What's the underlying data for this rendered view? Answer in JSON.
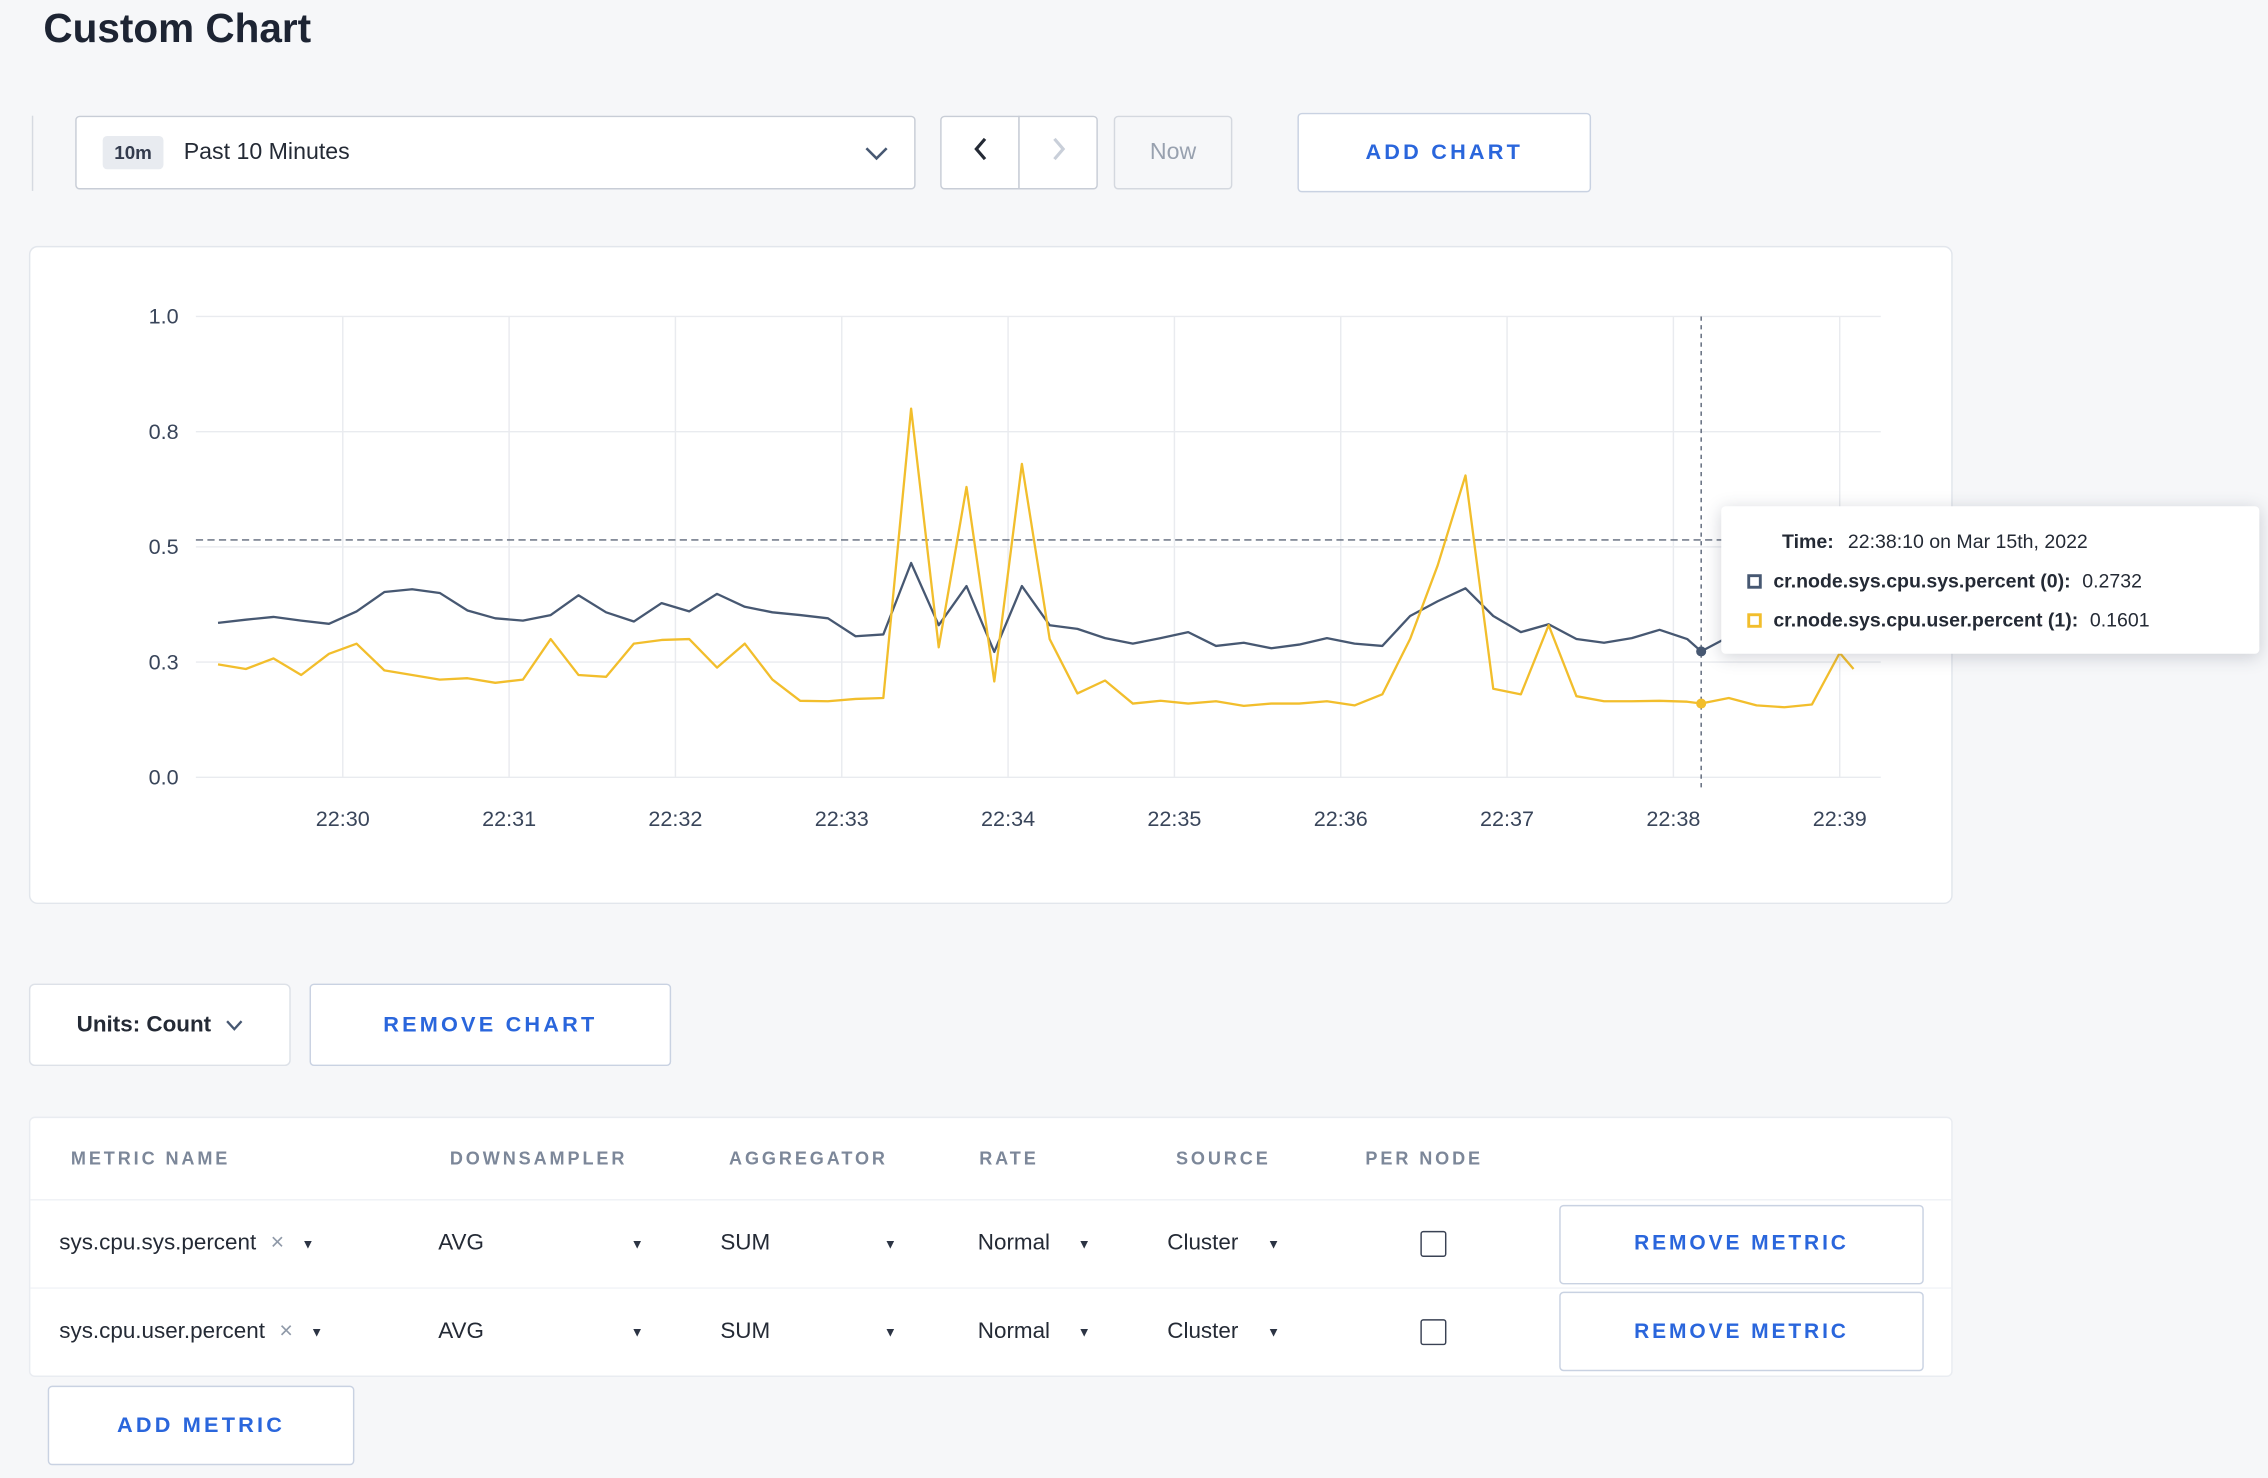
{
  "page": {
    "title": "Custom Chart"
  },
  "colors": {
    "accent": "#2a66dc",
    "series_sys": "#475872",
    "series_user": "#f2be2c"
  },
  "toolbar": {
    "time_badge": "10m",
    "time_label": "Past 10 Minutes",
    "now_label": "Now",
    "add_chart_label": "ADD CHART"
  },
  "chart_controls": {
    "units_label": "Units: Count",
    "remove_chart_label": "REMOVE CHART"
  },
  "metrics_table": {
    "headers": [
      "METRIC NAME",
      "DOWNSAMPLER",
      "AGGREGATOR",
      "RATE",
      "SOURCE",
      "PER NODE"
    ],
    "rows": [
      {
        "name": "sys.cpu.sys.percent",
        "downsampler": "AVG",
        "aggregator": "SUM",
        "rate": "Normal",
        "source": "Cluster",
        "per_node_checked": false,
        "remove_label": "REMOVE METRIC"
      },
      {
        "name": "sys.cpu.user.percent",
        "downsampler": "AVG",
        "aggregator": "SUM",
        "rate": "Normal",
        "source": "Cluster",
        "per_node_checked": false,
        "remove_label": "REMOVE METRIC"
      }
    ],
    "add_metric_label": "ADD METRIC"
  },
  "chart_data": {
    "type": "line",
    "x_axis": {
      "unit": "minutes after 22:30",
      "ticks": [
        0,
        1,
        2,
        3,
        4,
        5,
        6,
        7,
        8,
        9
      ],
      "tick_labels": [
        "22:30",
        "22:31",
        "22:32",
        "22:33",
        "22:34",
        "22:35",
        "22:36",
        "22:37",
        "22:38",
        "22:39"
      ],
      "range": [
        -0.883,
        9.25
      ]
    },
    "y_axis": {
      "ticks": [
        0,
        0.25,
        0.5,
        0.75,
        1.0
      ],
      "tick_labels": [
        "0.0",
        "0.3",
        "0.5",
        "0.8",
        "1.0"
      ],
      "range": [
        0,
        1
      ]
    },
    "series": [
      {
        "name": "cr.node.sys.cpu.sys.percent (0)",
        "color": "#475872",
        "points": [
          [
            -0.75,
            0.335
          ],
          [
            -0.583,
            0.342
          ],
          [
            -0.417,
            0.348
          ],
          [
            -0.25,
            0.34
          ],
          [
            -0.083,
            0.333
          ],
          [
            0.083,
            0.36
          ],
          [
            0.25,
            0.402
          ],
          [
            0.417,
            0.408
          ],
          [
            0.583,
            0.4
          ],
          [
            0.75,
            0.362
          ],
          [
            0.917,
            0.345
          ],
          [
            1.083,
            0.34
          ],
          [
            1.25,
            0.352
          ],
          [
            1.417,
            0.395
          ],
          [
            1.583,
            0.358
          ],
          [
            1.75,
            0.338
          ],
          [
            1.917,
            0.378
          ],
          [
            2.083,
            0.36
          ],
          [
            2.25,
            0.398
          ],
          [
            2.417,
            0.37
          ],
          [
            2.583,
            0.358
          ],
          [
            2.75,
            0.352
          ],
          [
            2.917,
            0.345
          ],
          [
            3.083,
            0.306
          ],
          [
            3.25,
            0.31
          ],
          [
            3.417,
            0.465
          ],
          [
            3.583,
            0.33
          ],
          [
            3.75,
            0.415
          ],
          [
            3.917,
            0.272
          ],
          [
            4.083,
            0.415
          ],
          [
            4.25,
            0.33
          ],
          [
            4.417,
            0.322
          ],
          [
            4.583,
            0.302
          ],
          [
            4.75,
            0.29
          ],
          [
            4.917,
            0.302
          ],
          [
            5.083,
            0.315
          ],
          [
            5.25,
            0.285
          ],
          [
            5.417,
            0.292
          ],
          [
            5.583,
            0.28
          ],
          [
            5.75,
            0.288
          ],
          [
            5.917,
            0.302
          ],
          [
            6.083,
            0.29
          ],
          [
            6.25,
            0.285
          ],
          [
            6.417,
            0.35
          ],
          [
            6.583,
            0.382
          ],
          [
            6.75,
            0.41
          ],
          [
            6.917,
            0.35
          ],
          [
            7.083,
            0.315
          ],
          [
            7.25,
            0.332
          ],
          [
            7.417,
            0.3
          ],
          [
            7.583,
            0.292
          ],
          [
            7.75,
            0.302
          ],
          [
            7.917,
            0.32
          ],
          [
            8.083,
            0.3
          ],
          [
            8.167,
            0.2732
          ],
          [
            8.333,
            0.305
          ],
          [
            8.417,
            0.31
          ]
        ]
      },
      {
        "name": "cr.node.sys.cpu.user.percent (1)",
        "color": "#f2be2c",
        "points": [
          [
            -0.75,
            0.245
          ],
          [
            -0.583,
            0.235
          ],
          [
            -0.417,
            0.258
          ],
          [
            -0.25,
            0.222
          ],
          [
            -0.083,
            0.268
          ],
          [
            0.083,
            0.29
          ],
          [
            0.25,
            0.232
          ],
          [
            0.417,
            0.222
          ],
          [
            0.583,
            0.212
          ],
          [
            0.75,
            0.215
          ],
          [
            0.917,
            0.205
          ],
          [
            1.083,
            0.212
          ],
          [
            1.25,
            0.3
          ],
          [
            1.417,
            0.222
          ],
          [
            1.583,
            0.218
          ],
          [
            1.75,
            0.29
          ],
          [
            1.917,
            0.298
          ],
          [
            2.083,
            0.3
          ],
          [
            2.25,
            0.238
          ],
          [
            2.417,
            0.29
          ],
          [
            2.583,
            0.212
          ],
          [
            2.75,
            0.166
          ],
          [
            2.917,
            0.165
          ],
          [
            3.083,
            0.17
          ],
          [
            3.25,
            0.172
          ],
          [
            3.417,
            0.8
          ],
          [
            3.583,
            0.282
          ],
          [
            3.75,
            0.63
          ],
          [
            3.917,
            0.208
          ],
          [
            4.083,
            0.68
          ],
          [
            4.25,
            0.3
          ],
          [
            4.417,
            0.182
          ],
          [
            4.583,
            0.21
          ],
          [
            4.75,
            0.16
          ],
          [
            4.917,
            0.166
          ],
          [
            5.083,
            0.16
          ],
          [
            5.25,
            0.165
          ],
          [
            5.417,
            0.155
          ],
          [
            5.583,
            0.16
          ],
          [
            5.75,
            0.16
          ],
          [
            5.917,
            0.165
          ],
          [
            6.083,
            0.156
          ],
          [
            6.25,
            0.18
          ],
          [
            6.417,
            0.3
          ],
          [
            6.583,
            0.46
          ],
          [
            6.75,
            0.655
          ],
          [
            6.917,
            0.192
          ],
          [
            7.083,
            0.18
          ],
          [
            7.25,
            0.33
          ],
          [
            7.417,
            0.176
          ],
          [
            7.583,
            0.165
          ],
          [
            7.75,
            0.165
          ],
          [
            7.917,
            0.166
          ],
          [
            8.083,
            0.164
          ],
          [
            8.167,
            0.1601
          ],
          [
            8.333,
            0.172
          ],
          [
            8.5,
            0.156
          ],
          [
            8.667,
            0.152
          ],
          [
            8.833,
            0.158
          ],
          [
            9.0,
            0.27
          ],
          [
            9.083,
            0.235
          ]
        ]
      }
    ],
    "crosshair": {
      "x": 8.167,
      "threshold": 0.515,
      "values": [
        0.2732,
        0.1601
      ]
    },
    "tooltip": {
      "time_label": "Time:",
      "time_value": "22:38:10 on Mar 15th, 2022",
      "rows": [
        {
          "label": "cr.node.sys.cpu.sys.percent (0):",
          "value": "0.2732",
          "color": "#475872"
        },
        {
          "label": "cr.node.sys.cpu.user.percent (1):",
          "value": "0.1601",
          "color": "#f2be2c"
        }
      ]
    }
  }
}
